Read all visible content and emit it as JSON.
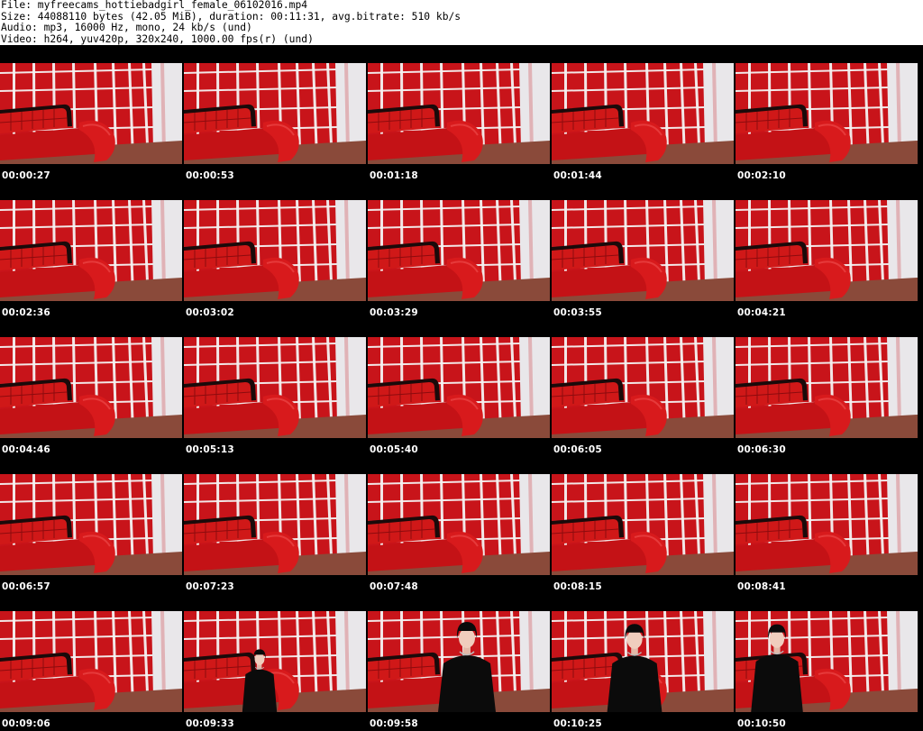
{
  "header": {
    "file_line": "File: myfreecams_hottiebadgirl_female_06102016.mp4",
    "size_line": "Size: 44088110 bytes (42.05 MiB), duration: 00:11:31, avg.bitrate: 510 kb/s",
    "audio_line": "Audio: mp3, 16000 Hz, mono, 24 kb/s (und)",
    "video_line": "Video: h264, yuv420p, 320x240, 1000.00 fps(r) (und)"
  },
  "colors": {
    "wall_red": "#c8141a",
    "grid_white": "#f4f2f2",
    "sofa_red": "#d01818",
    "sofa_black": "#1a0a0a",
    "floor": "#8a4a3a"
  },
  "thumbnails": [
    {
      "timestamp": "00:00:27",
      "person": false
    },
    {
      "timestamp": "00:00:53",
      "person": false
    },
    {
      "timestamp": "00:01:18",
      "person": false
    },
    {
      "timestamp": "00:01:44",
      "person": false
    },
    {
      "timestamp": "00:02:10",
      "person": false
    },
    {
      "timestamp": "00:02:36",
      "person": false
    },
    {
      "timestamp": "00:03:02",
      "person": false
    },
    {
      "timestamp": "00:03:29",
      "person": false
    },
    {
      "timestamp": "00:03:55",
      "person": false
    },
    {
      "timestamp": "00:04:21",
      "person": false
    },
    {
      "timestamp": "00:04:46",
      "person": false
    },
    {
      "timestamp": "00:05:13",
      "person": false
    },
    {
      "timestamp": "00:05:40",
      "person": false
    },
    {
      "timestamp": "00:06:05",
      "person": false
    },
    {
      "timestamp": "00:06:30",
      "person": false
    },
    {
      "timestamp": "00:06:57",
      "person": false
    },
    {
      "timestamp": "00:07:23",
      "person": false
    },
    {
      "timestamp": "00:07:48",
      "person": false
    },
    {
      "timestamp": "00:08:15",
      "person": false
    },
    {
      "timestamp": "00:08:41",
      "person": false
    },
    {
      "timestamp": "00:09:06",
      "person": false
    },
    {
      "timestamp": "00:09:33",
      "person": true
    },
    {
      "timestamp": "00:09:58",
      "person": true
    },
    {
      "timestamp": "00:10:25",
      "person": true
    },
    {
      "timestamp": "00:10:50",
      "person": true
    }
  ]
}
